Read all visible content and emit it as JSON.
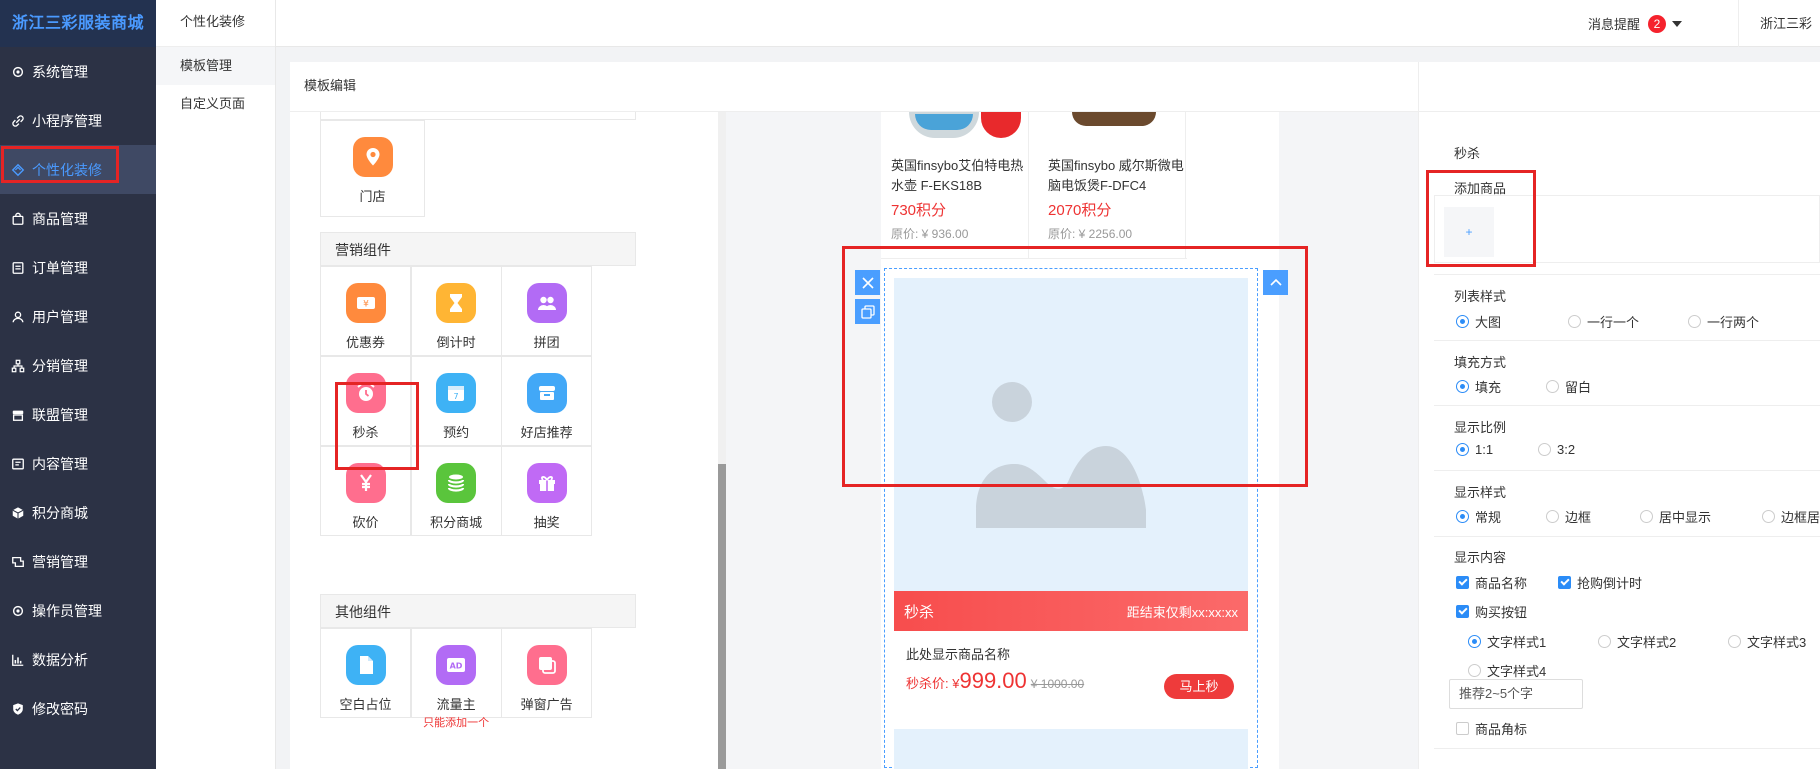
{
  "app": {
    "brand": "浙江三彩服装商城"
  },
  "sidebar": {
    "items": [
      {
        "label": "系统管理",
        "icon": "gear-icon"
      },
      {
        "label": "小程序管理",
        "icon": "link-icon"
      },
      {
        "label": "个性化装修",
        "icon": "diamond-icon",
        "active": true
      },
      {
        "label": "商品管理",
        "icon": "bag-icon"
      },
      {
        "label": "订单管理",
        "icon": "list-icon"
      },
      {
        "label": "用户管理",
        "icon": "user-icon"
      },
      {
        "label": "分销管理",
        "icon": "tree-icon"
      },
      {
        "label": "联盟管理",
        "icon": "store-icon"
      },
      {
        "label": "内容管理",
        "icon": "content-icon"
      },
      {
        "label": "积分商城",
        "icon": "cube-icon"
      },
      {
        "label": "营销管理",
        "icon": "marketing-icon"
      },
      {
        "label": "操作员管理",
        "icon": "gear-icon"
      },
      {
        "label": "数据分析",
        "icon": "chart-icon"
      },
      {
        "label": "修改密码",
        "icon": "shield-icon"
      }
    ]
  },
  "submenu": {
    "title": "个性化装修",
    "items": [
      {
        "label": "模板管理",
        "active": true
      },
      {
        "label": "自定义页面",
        "active": false
      }
    ]
  },
  "topbar": {
    "message_label": "消息提醒",
    "message_count": "2",
    "user_label": "浙江三彩"
  },
  "panel": {
    "title": "模板编辑"
  },
  "components": {
    "store_label": "门店",
    "marketing_title": "营销组件",
    "marketing": [
      {
        "label": "优惠券",
        "icon": "coupon-icon",
        "color": "#ff8a3d"
      },
      {
        "label": "倒计时",
        "icon": "hourglass-icon",
        "color": "#ffb534"
      },
      {
        "label": "拼团",
        "icon": "group-icon",
        "color": "#b26bf5"
      },
      {
        "label": "秒杀",
        "icon": "alarm-clock-icon",
        "color": "#ff6e8e"
      },
      {
        "label": "预约",
        "icon": "calendar-icon",
        "color": "#3eb2f5"
      },
      {
        "label": "好店推荐",
        "icon": "shop-icon",
        "color": "#42a8f7"
      },
      {
        "label": "砍价",
        "icon": "yen-icon",
        "color": "#ff6e8e"
      },
      {
        "label": "积分商城",
        "icon": "coins-icon",
        "color": "#5ac53c"
      },
      {
        "label": "抽奖",
        "icon": "gift-icon",
        "color": "#c06af5"
      }
    ],
    "other_title": "其他组件",
    "other": [
      {
        "label": "空白占位",
        "icon": "blank-page-icon",
        "color": "#3eb2f5",
        "sub": ""
      },
      {
        "label": "流量主",
        "icon": "ad-icon",
        "color": "#b26bf5",
        "sub": "只能添加一个"
      },
      {
        "label": "弹窗广告",
        "icon": "popup-icon",
        "color": "#ff6e8e",
        "sub": ""
      }
    ]
  },
  "preview": {
    "products": [
      {
        "title": "英国finsybo艾伯特电热水壶 F-EKS18B",
        "points": "730积分",
        "original": "原价: ¥ 936.00"
      },
      {
        "title": "英国finsybo 威尔斯微电脑电饭煲F-DFC4",
        "points": "2070积分",
        "original": "原价: ¥ 2256.00"
      }
    ],
    "seckill": {
      "label": "秒杀",
      "timer": "距结束仅剩xx:xx:xx",
      "product_name": "此处显示商品名称",
      "price_label": "秒杀价: ¥",
      "price": "999.00",
      "original": "¥ 1000.00",
      "buy": "马上秒"
    }
  },
  "settings": {
    "section_title": "秒杀",
    "add_goods_label": "添加商品",
    "add_button": "+",
    "list_style": {
      "label": "列表样式",
      "options": [
        "大图",
        "一行一个",
        "一行两个"
      ],
      "selected": "大图"
    },
    "fill_mode": {
      "label": "填充方式",
      "options": [
        "填充",
        "留白"
      ],
      "selected": "填充"
    },
    "ratio": {
      "label": "显示比例",
      "options": [
        "1:1",
        "3:2"
      ],
      "selected": "1:1"
    },
    "display_style": {
      "label": "显示样式",
      "options": [
        "常规",
        "边框",
        "居中显示",
        "边框居"
      ],
      "selected": "常规"
    },
    "display_content": {
      "label": "显示内容",
      "checks": [
        {
          "label": "商品名称",
          "checked": true
        },
        {
          "label": "抢购倒计时",
          "checked": true
        },
        {
          "label": "购买按钮",
          "checked": true
        }
      ],
      "text_styles": [
        "文字样式1",
        "文字样式2",
        "文字样式3",
        "文字样式4"
      ],
      "text_style_selected": "文字样式1",
      "placeholder": "推荐2~5个字",
      "corner_label": "商品角标",
      "corner_checked": false
    }
  }
}
